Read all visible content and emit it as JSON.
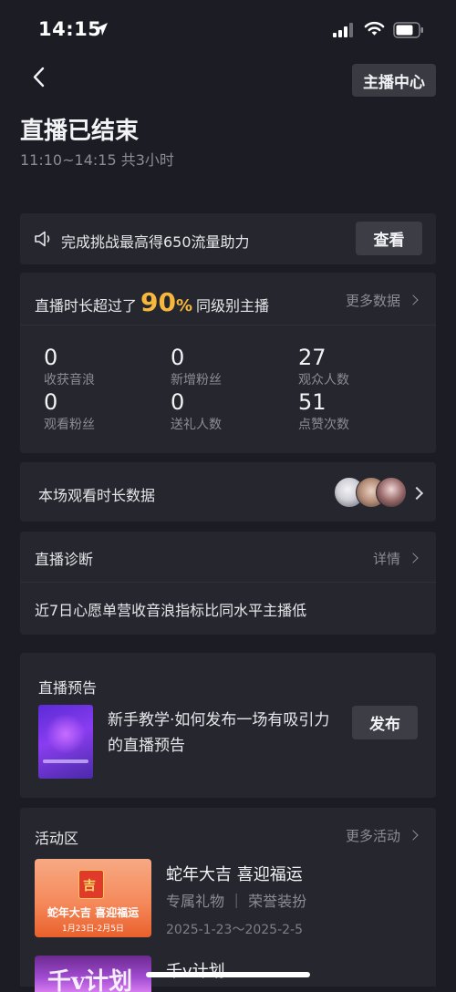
{
  "status": {
    "time": "14:15"
  },
  "header": {
    "host_center": "主播中心",
    "title": "直播已结束",
    "subtitle": "11:10~14:15 共3小时"
  },
  "challenge": {
    "text": "完成挑战最高得650流量助力",
    "button": "查看"
  },
  "stats": {
    "head_prefix": "直播时长超过了",
    "percent": "90",
    "percent_sign": "%",
    "head_suffix": "同级别主播",
    "more": "更多数据",
    "items": [
      {
        "value": "0",
        "label": "收获音浪"
      },
      {
        "value": "0",
        "label": "新增粉丝"
      },
      {
        "value": "27",
        "label": "观众人数"
      },
      {
        "value": "0",
        "label": "观看粉丝"
      },
      {
        "value": "0",
        "label": "送礼人数"
      },
      {
        "value": "51",
        "label": "点赞次数"
      }
    ]
  },
  "watch_duration": {
    "label": "本场观看时长数据"
  },
  "diagnosis": {
    "title": "直播诊断",
    "more": "详情",
    "text": "近7日心愿单营收音浪指标比同水平主播低"
  },
  "preview": {
    "title": "直播预告",
    "desc": "新手教学·如何发布一场有吸引力的直播预告",
    "button": "发布"
  },
  "activity": {
    "title": "活动区",
    "more": "更多活动",
    "items": [
      {
        "title": "蛇年大吉 喜迎福运",
        "sub": "专属礼物 ｜ 荣誉装扮",
        "date": "2025-1-23～2025-2-5",
        "banner_char": "吉",
        "banner_title": "蛇年大吉 喜迎福运",
        "banner_date": "1月23日-2月5日"
      },
      {
        "title": "千v计划"
      }
    ]
  },
  "colors": {
    "background": "#1c1d24",
    "card": "#26272e",
    "accent": "#f6b73c"
  }
}
